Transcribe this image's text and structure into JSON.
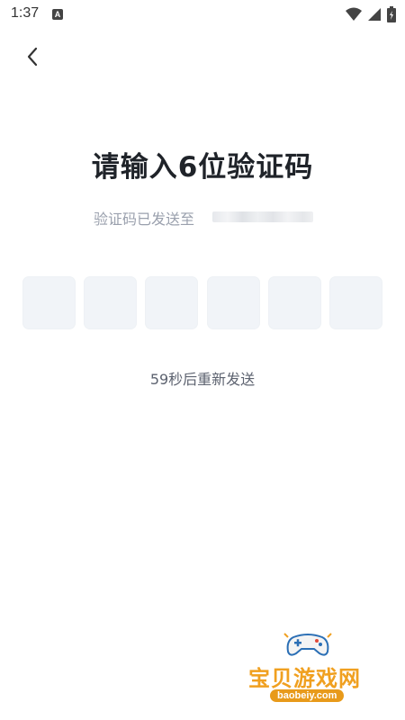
{
  "status_bar": {
    "time": "1:37",
    "notification_icon": "A"
  },
  "header": {
    "back_icon": "chevron-left-icon"
  },
  "main": {
    "title": "请输入6位验证码",
    "subtitle": "验证码已发送至",
    "code_length": 6,
    "resend_text": "59秒后重新发送"
  },
  "watermark": {
    "brand": "宝贝游戏网",
    "url": "baobeiy.com"
  },
  "colors": {
    "title": "#1f2329",
    "subtitle": "#9aa0ad",
    "box_bg": "#f1f4f8",
    "resend": "#5d6370",
    "watermark": "#f0a020"
  }
}
